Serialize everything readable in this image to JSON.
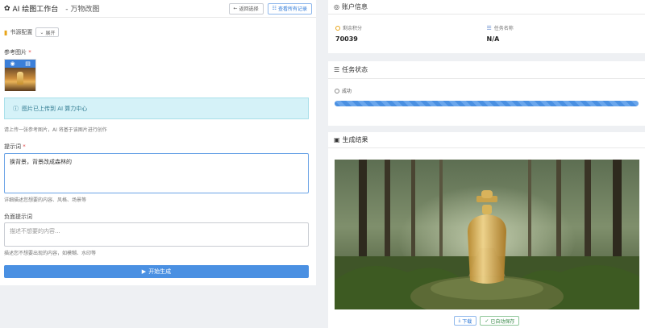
{
  "header": {
    "title": "AI 绘图工作台",
    "subtitle": "- 万物改图",
    "back_label": "返回选择",
    "history_label": "查看所有记录"
  },
  "settings": {
    "label": "书源配置",
    "toggle_label": "展开"
  },
  "reference": {
    "label": "参考图片",
    "required": "*"
  },
  "info_banner": "图片已上传到 AI 算力中心",
  "hint_upload": "请上传一张参考图片，AI 将基于该图片进行创作",
  "prompt": {
    "label": "提示词",
    "required": "*",
    "value": "换背景，背景改成森林的",
    "hint": "详细描述您想要的内容、风格、场景等"
  },
  "negative": {
    "label": "负面提示词",
    "placeholder": "描述不想要的内容...",
    "hint": "描述您不想要出现的内容，如模糊、水印等"
  },
  "generate_label": "开始生成",
  "account": {
    "title": "账户信息",
    "balance_label": "剩余积分",
    "balance_value": "70039",
    "task_label": "任务名称",
    "task_value": "N/A"
  },
  "task": {
    "title": "任务状态",
    "status": "成功",
    "progress": 1.0
  },
  "result": {
    "title": "生成结果",
    "download_label": "下载",
    "save_label": "已自动保存"
  },
  "colors": {
    "primary": "#4a90e2",
    "info_bg": "#d5f2f8",
    "success": "#3a8a4a"
  }
}
